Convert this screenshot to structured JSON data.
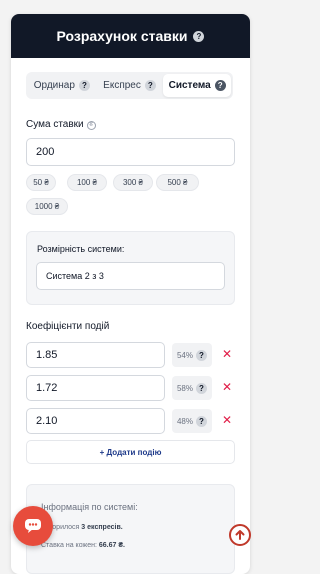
{
  "header": {
    "title": "Розрахунок ставки",
    "help_icon": "question-icon"
  },
  "tabs": [
    {
      "label": "Ординар",
      "active": false
    },
    {
      "label": "Експрес",
      "active": false
    },
    {
      "label": "Система",
      "active": true
    }
  ],
  "stake": {
    "label": "Сума ставки",
    "hint_symbol": "₴",
    "value": "200",
    "presets": [
      "50 ₴",
      "100 ₴",
      "300 ₴",
      "500 ₴",
      "1000 ₴"
    ]
  },
  "system": {
    "label": "Розмірність системи:",
    "value": "Система 2 з 3"
  },
  "odds": {
    "label": "Коефіцієнти подій",
    "rows": [
      {
        "value": "1.85",
        "percent": "54%"
      },
      {
        "value": "1.72",
        "percent": "58%"
      },
      {
        "value": "2.10",
        "percent": "48%"
      }
    ],
    "remove_symbol": "✕",
    "add_label": "+ Додати подію"
  },
  "info": {
    "title": "Інформація по системі:",
    "combos_prefix": "Утворилося",
    "combos_value": "3 експресів.",
    "stake_prefix": "Ставка на кожен:",
    "stake_value": "66.67 ₴."
  },
  "colors": {
    "header_bg": "#111827",
    "accent_red": "#e11d48",
    "chat_bg": "#e74c3c",
    "add_link": "#1e3a8a"
  },
  "icons": {
    "chat": "chat-bubble-icon",
    "scroll_up": "arrow-up-circle-icon"
  }
}
